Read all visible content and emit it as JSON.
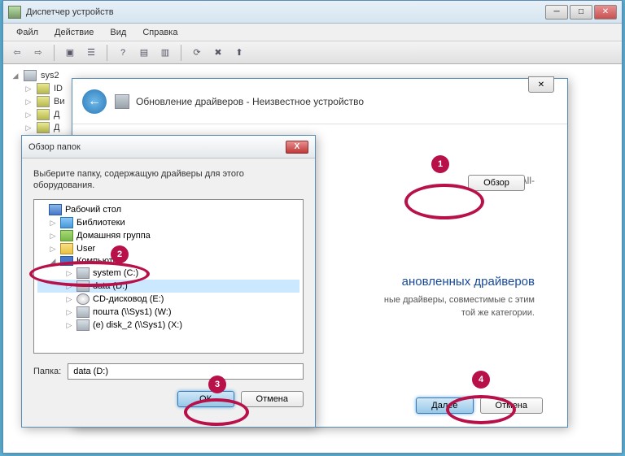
{
  "main": {
    "title": "Диспетчер устройств",
    "menu": {
      "file": "Файл",
      "action": "Действие",
      "view": "Вид",
      "help": "Справка"
    },
    "tree": {
      "root": "sys2",
      "items": [
        "ID",
        "Ви",
        "Д",
        "Д"
      ]
    }
  },
  "update": {
    "title": "Обновление драйверов - Неизвестное устройство",
    "controller_fragment": "Controller All-",
    "browse_btn": "Обзор",
    "section_title": "ановленных драйверов",
    "section_text_1": "ные драйверы, совместимые с этим",
    "section_text_2": "той же категории.",
    "next": "Далее",
    "cancel": "Отмена"
  },
  "folder": {
    "title": "Обзор папок",
    "instruction": "Выберите папку, содержащую драйверы для этого оборудования.",
    "tree": {
      "desktop": "Рабочий стол",
      "libraries": "Библиотеки",
      "homegroup": "Домашняя группа",
      "user": "User",
      "computer": "Компьютер",
      "system": "system (C:)",
      "data": "data (D:)",
      "cd": "CD-дисковод (E:)",
      "mail": "пошта (\\\\Sys1) (W:)",
      "disk2": "(е) disk_2 (\\\\Sys1) (X:)"
    },
    "folder_label": "Папка:",
    "folder_value": "data (D:)",
    "ok": "ОК",
    "cancel": "Отмена"
  },
  "callouts": {
    "1": "1",
    "2": "2",
    "3": "3",
    "4": "4"
  }
}
